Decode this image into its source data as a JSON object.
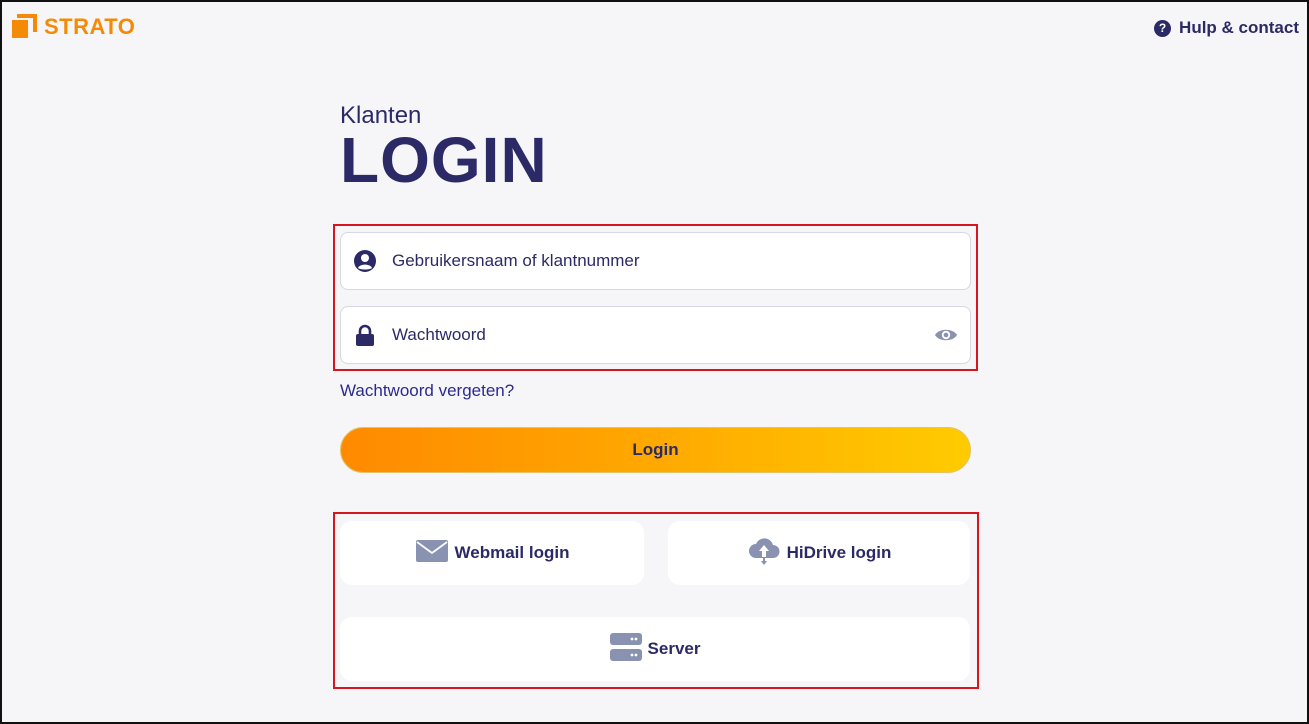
{
  "brand": {
    "name": "STRATO",
    "color": "#f58a07"
  },
  "header": {
    "help_label": "Hulp & contact",
    "help_icon": "question-icon"
  },
  "heading": {
    "subtitle": "Klanten",
    "title": "LOGIN"
  },
  "form": {
    "username_placeholder": "Gebruikersnaam of klantnummer",
    "password_placeholder": "Wachtwoord",
    "forgot_label": "Wachtwoord vergeten?",
    "login_label": "Login"
  },
  "shortcuts": {
    "webmail_label": "Webmail login",
    "hidrive_label": "HiDrive login",
    "server_label": "Server"
  },
  "colors": {
    "text": "#2c2a66",
    "accent": "#f58a07",
    "link": "#2d2a8f",
    "gradient_start": "#ff8a00",
    "gradient_end": "#ffcb00",
    "highlight": "#d6161e",
    "icon_muted": "#8a92b2"
  }
}
